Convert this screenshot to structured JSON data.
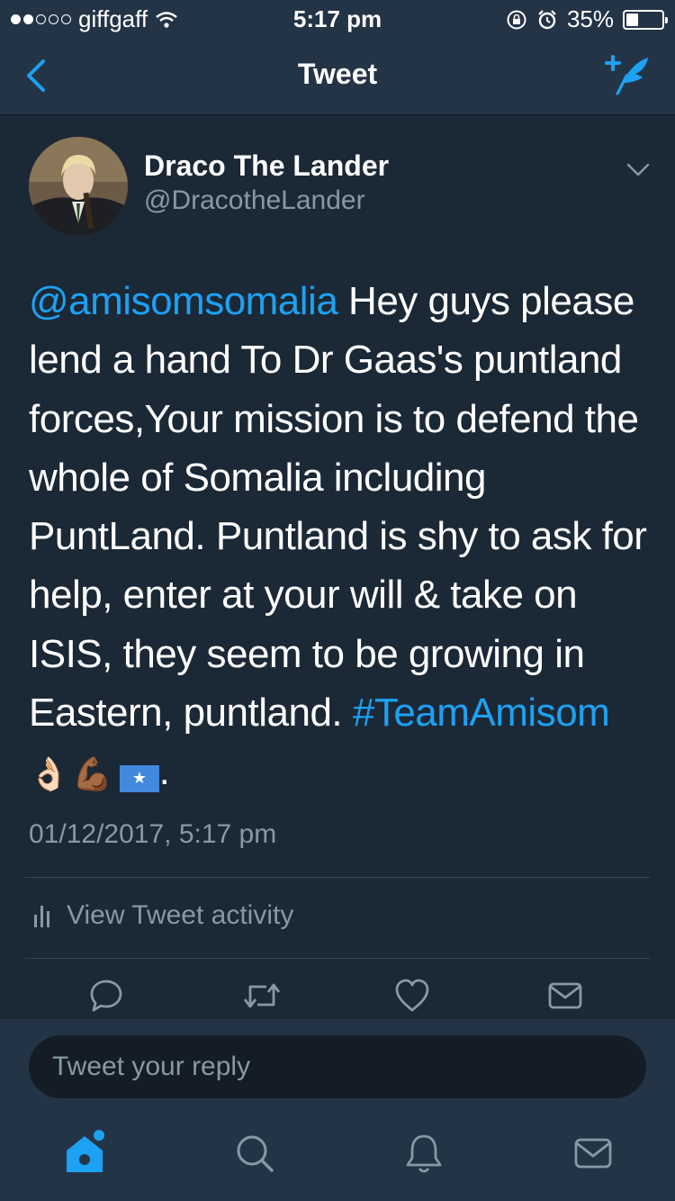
{
  "status_bar": {
    "carrier": "giffgaff",
    "time": "5:17 pm",
    "battery": "35%",
    "battery_level": 0.35
  },
  "nav": {
    "title": "Tweet"
  },
  "tweet": {
    "author_name": "Draco The Lander",
    "author_handle": "@DracotheLander",
    "mention": "@amisomsomalia",
    "body": " Hey guys please lend a hand To Dr Gaas's puntland forces,Your mission is to defend the whole of Somalia including PuntLand. Puntland  is shy to ask for help, enter at your will & take on ISIS, they seem to be growing in Eastern, puntland. ",
    "hashtag": "#TeamAmisom",
    "emoji_ok": "👌🏻",
    "emoji_muscle": "💪🏾",
    "emoji_flag_star": "★",
    "trailing": ".",
    "timestamp": "01/12/2017, 5:17 pm",
    "activity_label": "View Tweet activity"
  },
  "reply": {
    "placeholder": "Tweet your reply"
  },
  "colors": {
    "background": "#1b2836",
    "bar": "#243447",
    "accent": "#1da1f2",
    "muted": "#8899a6"
  },
  "icons": {
    "back": "chevron-left-icon",
    "compose": "compose-tweet-icon",
    "caret": "chevron-down-icon",
    "activity": "bar-chart-icon",
    "reply": "reply-icon",
    "retweet": "retweet-icon",
    "like": "heart-icon",
    "dm": "envelope-icon",
    "home": "home-icon",
    "search": "search-icon",
    "notifications": "bell-icon",
    "messages": "envelope-icon"
  }
}
